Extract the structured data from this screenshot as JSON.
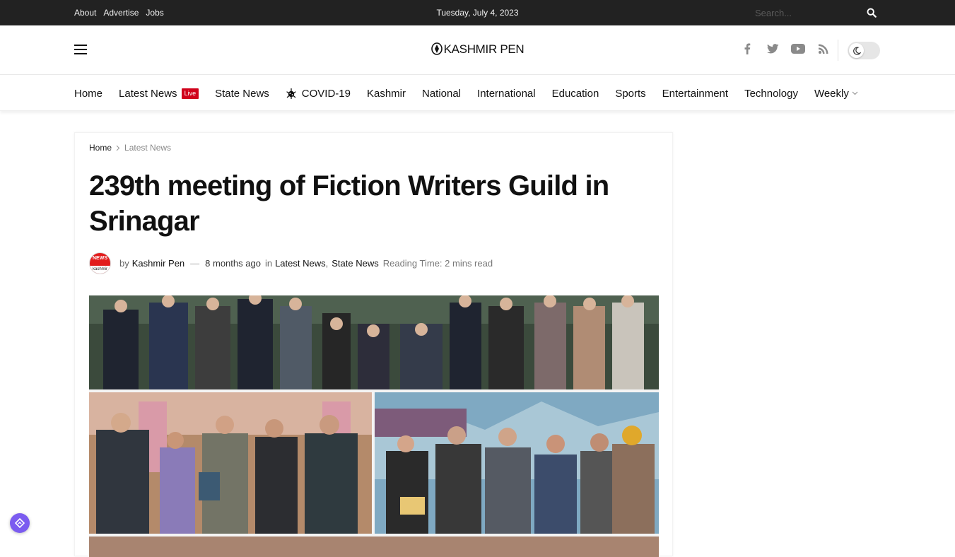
{
  "topbar": {
    "links": [
      "About",
      "Advertise",
      "Jobs"
    ],
    "date": "Tuesday, July 4, 2023",
    "search_placeholder": "Search..."
  },
  "header": {
    "logo_text": "KASHMIR PEN",
    "social_icons": [
      "facebook-icon",
      "twitter-icon",
      "youtube-icon",
      "rss-icon"
    ],
    "dark_mode_toggle": "moon-icon"
  },
  "nav": {
    "items": [
      {
        "label": "Home"
      },
      {
        "label": "Latest News",
        "badge": "Live"
      },
      {
        "label": "State News"
      },
      {
        "label": "COVID-19",
        "icon": "virus-icon"
      },
      {
        "label": "Kashmir"
      },
      {
        "label": "National"
      },
      {
        "label": "International"
      },
      {
        "label": "Education"
      },
      {
        "label": "Sports"
      },
      {
        "label": "Entertainment"
      },
      {
        "label": "Technology"
      },
      {
        "label": "Weekly",
        "icon": "chevron-down-icon"
      }
    ]
  },
  "article": {
    "breadcrumb": {
      "home": "Home",
      "current": "Latest News"
    },
    "title": "239th meeting of Fiction Writers Guild in Srinagar",
    "meta": {
      "by": "by",
      "author": "Kashmir Pen",
      "dash": "—",
      "time": "8 months ago",
      "in": "in",
      "categories": [
        "Latest News",
        "State News"
      ],
      "cat_sep": ",",
      "reading_time": "Reading Time: 2 mins read"
    },
    "avatar": {
      "line1": "NEWS",
      "line2": "kashmir"
    }
  },
  "colors": {
    "topbar": "#222222",
    "live_badge": "#d0021b",
    "fab": "#7b5cf0"
  }
}
